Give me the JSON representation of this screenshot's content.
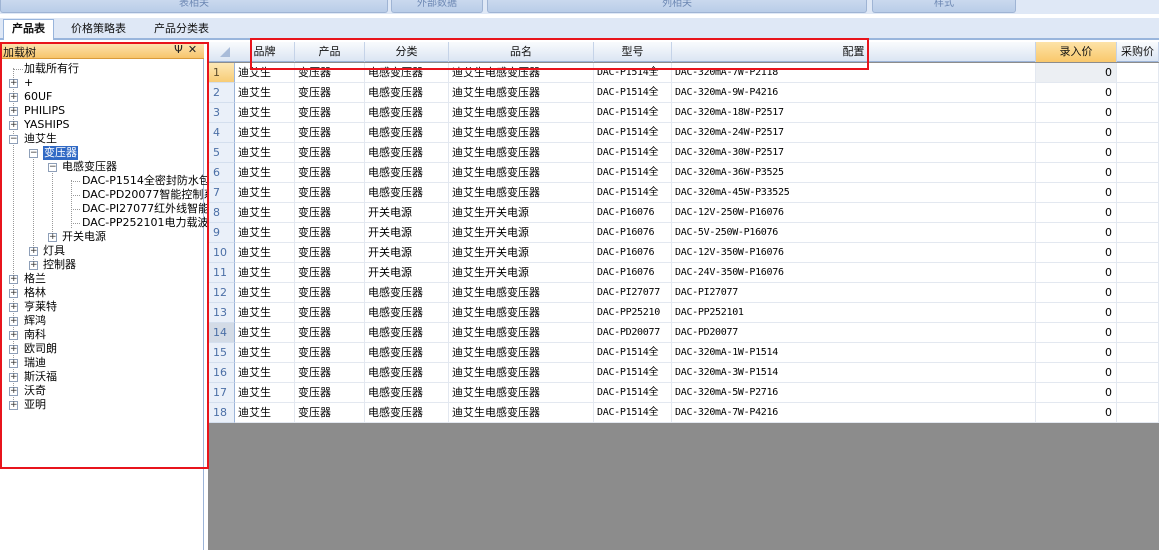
{
  "ribbon": {
    "groups": [
      {
        "label": "表相关"
      },
      {
        "label": "外部数据"
      },
      {
        "label": "列相关"
      },
      {
        "label": "样式"
      }
    ]
  },
  "tabs": [
    {
      "label": "产品表",
      "active": true
    },
    {
      "label": "价格策略表",
      "active": false
    },
    {
      "label": "产品分类表",
      "active": false
    }
  ],
  "tree_panel": {
    "title": "加载树",
    "pin_glyph": "Ψ",
    "close_glyph": "✕",
    "nodes": [
      {
        "label": "加载所有行"
      },
      {
        "label": "+"
      },
      {
        "label": "60UF"
      },
      {
        "label": "PHILIPS"
      },
      {
        "label": "YASHIPS"
      },
      {
        "label": "迪艾生"
      },
      {
        "label": "变压器"
      },
      {
        "label": "电感变压器"
      },
      {
        "label": "DAC-P1514全密封防水包"
      },
      {
        "label": "DAC-PD20077智能控制系"
      },
      {
        "label": "DAC-PI27077红外线智能"
      },
      {
        "label": "DAC-PP252101电力载波"
      },
      {
        "label": "开关电源"
      },
      {
        "label": "灯具"
      },
      {
        "label": "控制器"
      },
      {
        "label": "格兰"
      },
      {
        "label": "格林"
      },
      {
        "label": "亨莱特"
      },
      {
        "label": "辉鸿"
      },
      {
        "label": "南科"
      },
      {
        "label": "欧司朗"
      },
      {
        "label": "瑞迪"
      },
      {
        "label": "斯沃福"
      },
      {
        "label": "沃奇"
      },
      {
        "label": "亚明"
      }
    ]
  },
  "grid": {
    "columns": [
      "品牌",
      "产品",
      "分类",
      "品名",
      "型号",
      "配置",
      "录入价",
      "采购价"
    ],
    "rows": [
      {
        "n": "1",
        "brand": "迪艾生",
        "product": "变压器",
        "category": "电感变压器",
        "name": "迪艾生电感变压器",
        "model": "DAC-P1514全",
        "config": "DAC-320mA-7W-P2118",
        "price": "0"
      },
      {
        "n": "2",
        "brand": "迪艾生",
        "product": "变压器",
        "category": "电感变压器",
        "name": "迪艾生电感变压器",
        "model": "DAC-P1514全",
        "config": "DAC-320mA-9W-P4216",
        "price": "0"
      },
      {
        "n": "3",
        "brand": "迪艾生",
        "product": "变压器",
        "category": "电感变压器",
        "name": "迪艾生电感变压器",
        "model": "DAC-P1514全",
        "config": "DAC-320mA-18W-P2517",
        "price": "0"
      },
      {
        "n": "4",
        "brand": "迪艾生",
        "product": "变压器",
        "category": "电感变压器",
        "name": "迪艾生电感变压器",
        "model": "DAC-P1514全",
        "config": "DAC-320mA-24W-P2517",
        "price": "0"
      },
      {
        "n": "5",
        "brand": "迪艾生",
        "product": "变压器",
        "category": "电感变压器",
        "name": "迪艾生电感变压器",
        "model": "DAC-P1514全",
        "config": "DAC-320mA-30W-P2517",
        "price": "0"
      },
      {
        "n": "6",
        "brand": "迪艾生",
        "product": "变压器",
        "category": "电感变压器",
        "name": "迪艾生电感变压器",
        "model": "DAC-P1514全",
        "config": "DAC-320mA-36W-P3525",
        "price": "0"
      },
      {
        "n": "7",
        "brand": "迪艾生",
        "product": "变压器",
        "category": "电感变压器",
        "name": "迪艾生电感变压器",
        "model": "DAC-P1514全",
        "config": "DAC-320mA-45W-P33525",
        "price": "0"
      },
      {
        "n": "8",
        "brand": "迪艾生",
        "product": "变压器",
        "category": "开关电源",
        "name": "迪艾生开关电源",
        "model": "DAC-P16076",
        "config": "DAC-12V-250W-P16076",
        "price": "0"
      },
      {
        "n": "9",
        "brand": "迪艾生",
        "product": "变压器",
        "category": "开关电源",
        "name": "迪艾生开关电源",
        "model": "DAC-P16076",
        "config": "DAC-5V-250W-P16076",
        "price": "0"
      },
      {
        "n": "10",
        "brand": "迪艾生",
        "product": "变压器",
        "category": "开关电源",
        "name": "迪艾生开关电源",
        "model": "DAC-P16076",
        "config": "DAC-12V-350W-P16076",
        "price": "0"
      },
      {
        "n": "11",
        "brand": "迪艾生",
        "product": "变压器",
        "category": "开关电源",
        "name": "迪艾生开关电源",
        "model": "DAC-P16076",
        "config": "DAC-24V-350W-P16076",
        "price": "0"
      },
      {
        "n": "12",
        "brand": "迪艾生",
        "product": "变压器",
        "category": "电感变压器",
        "name": "迪艾生电感变压器",
        "model": "DAC-PI27077",
        "config": "DAC-PI27077",
        "price": "0"
      },
      {
        "n": "13",
        "brand": "迪艾生",
        "product": "变压器",
        "category": "电感变压器",
        "name": "迪艾生电感变压器",
        "model": "DAC-PP25210",
        "config": "DAC-PP252101",
        "price": "0"
      },
      {
        "n": "14",
        "brand": "迪艾生",
        "product": "变压器",
        "category": "电感变压器",
        "name": "迪艾生电感变压器",
        "model": "DAC-PD20077",
        "config": "DAC-PD20077",
        "price": "0"
      },
      {
        "n": "15",
        "brand": "迪艾生",
        "product": "变压器",
        "category": "电感变压器",
        "name": "迪艾生电感变压器",
        "model": "DAC-P1514全",
        "config": "DAC-320mA-1W-P1514",
        "price": "0"
      },
      {
        "n": "16",
        "brand": "迪艾生",
        "product": "变压器",
        "category": "电感变压器",
        "name": "迪艾生电感变压器",
        "model": "DAC-P1514全",
        "config": "DAC-320mA-3W-P1514",
        "price": "0"
      },
      {
        "n": "17",
        "brand": "迪艾生",
        "product": "变压器",
        "category": "电感变压器",
        "name": "迪艾生电感变压器",
        "model": "DAC-P1514全",
        "config": "DAC-320mA-5W-P2716",
        "price": "0"
      },
      {
        "n": "18",
        "brand": "迪艾生",
        "product": "变压器",
        "category": "电感变压器",
        "name": "迪艾生电感变压器",
        "model": "DAC-P1514全",
        "config": "DAC-320mA-7W-P4216",
        "price": "0"
      }
    ]
  },
  "colors": {
    "annotation_red": "#e8141c",
    "selection_blue": "#316ac5",
    "panel_header_orange": "#f7c46b",
    "empty_area_gray": "#8c8c8c"
  }
}
